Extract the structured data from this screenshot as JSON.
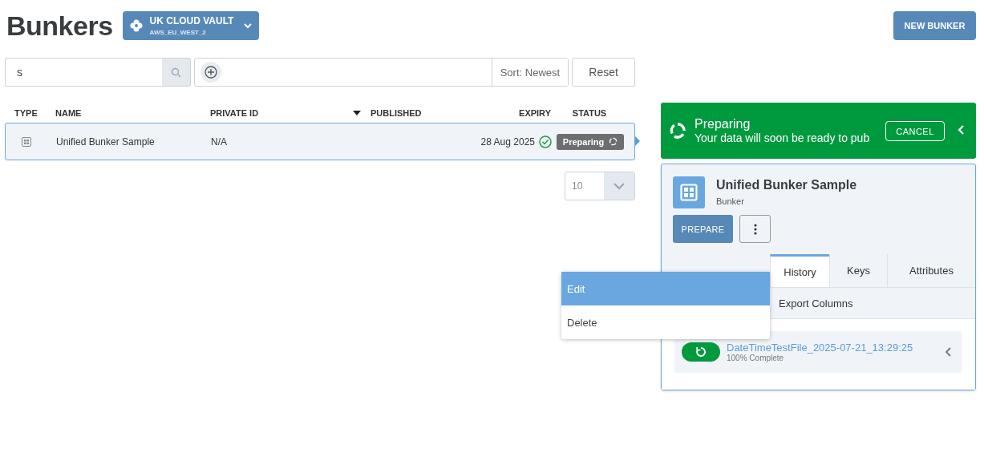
{
  "header": {
    "title": "Bunkers",
    "vault": {
      "name": "UK CLOUD VAULT",
      "region": "AWS_EU_WEST_2"
    },
    "new_button": "NEW BUNKER"
  },
  "toolbar": {
    "search": {
      "value": "s"
    },
    "sort": "Sort: Newest",
    "reset": "Reset"
  },
  "table": {
    "columns": [
      {
        "label": "TYPE",
        "kind": "type"
      },
      {
        "label": "NAME",
        "kind": "name"
      },
      {
        "label": "PRIVATE ID",
        "kind": "id"
      },
      {
        "label": "PUBLISHED",
        "kind": "published",
        "sorted": true
      },
      {
        "label": "EXPIRY",
        "kind": "expiry"
      },
      {
        "label": "STATUS",
        "kind": "status"
      }
    ],
    "rows": [
      {
        "name": "Unified Bunker Sample",
        "private_id": "N/A",
        "expiry": "28 Aug 2025",
        "expiry_ok": true,
        "status": "Preparing",
        "selected": true
      }
    ]
  },
  "pagination": {
    "page_size": "10"
  },
  "banner": {
    "title": "Preparing",
    "message": "Your data will soon be ready to pub",
    "cancel": "CANCEL"
  },
  "detail": {
    "name": "Unified Bunker Sample",
    "type": "Bunker",
    "prepare": "PREPARE",
    "tabs": [
      {
        "label": "History",
        "selected": true
      },
      {
        "label": "Keys",
        "selected": false
      },
      {
        "label": "Attributes",
        "selected": false
      }
    ],
    "subtabs": [
      {
        "label": "Export Columns",
        "selected": false
      }
    ],
    "history": [
      {
        "file": "DateTimeTestFile_2025-07-21_13:29:25",
        "progress": "100% Complete",
        "kind": "running"
      }
    ]
  },
  "menu": [
    {
      "label": "Edit",
      "selected": true
    },
    {
      "label": "Delete",
      "selected": false
    }
  ]
}
